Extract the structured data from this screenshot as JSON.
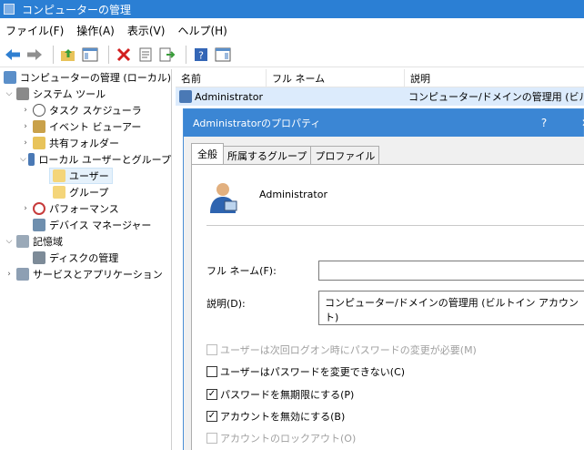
{
  "window": {
    "title": "コンピューターの管理"
  },
  "menu": [
    "ファイル(F)",
    "操作(A)",
    "表示(V)",
    "ヘルプ(H)"
  ],
  "tree": {
    "root": "コンピューターの管理 (ローカル)",
    "system_tools": "システム ツール",
    "task_scheduler": "タスク スケジューラ",
    "event_viewer": "イベント ビューアー",
    "shared_folders": "共有フォルダー",
    "local_users_groups": "ローカル ユーザーとグループ",
    "users": "ユーザー",
    "groups": "グループ",
    "performance": "パフォーマンス",
    "device_manager": "デバイス マネージャー",
    "storage": "記憶域",
    "disk_management": "ディスクの管理",
    "services_apps": "サービスとアプリケーション"
  },
  "list": {
    "columns": [
      "名前",
      "フル ネーム",
      "説明"
    ],
    "row": {
      "name": "Administrator",
      "fullname": "",
      "description": "コンピューター/ドメインの管理用 (ビルトイ"
    }
  },
  "dialog": {
    "title": "Administratorのプロパティ",
    "help": "?",
    "close": "✕",
    "tabs": [
      "全般",
      "所属するグループ",
      "プロファイル"
    ],
    "account_name": "Administrator",
    "fullname_label": "フル ネーム(F):",
    "fullname_value": "",
    "description_label": "説明(D):",
    "description_value": "コンピューター/ドメインの管理用 (ビルトイン アカウント)",
    "checkboxes": [
      {
        "label": "ユーザーは次回ログオン時にパスワードの変更が必要(M)",
        "checked": false,
        "disabled": true
      },
      {
        "label": "ユーザーはパスワードを変更できない(C)",
        "checked": false,
        "disabled": false
      },
      {
        "label": "パスワードを無期限にする(P)",
        "checked": true,
        "disabled": false
      },
      {
        "label": "アカウントを無効にする(B)",
        "checked": true,
        "disabled": false
      },
      {
        "label": "アカウントのロックアウト(O)",
        "checked": false,
        "disabled": true
      }
    ]
  },
  "colors": {
    "title_bar": "#2b7fd4",
    "dialog_title": "#3b86d4",
    "selection": "#dcebfc"
  }
}
